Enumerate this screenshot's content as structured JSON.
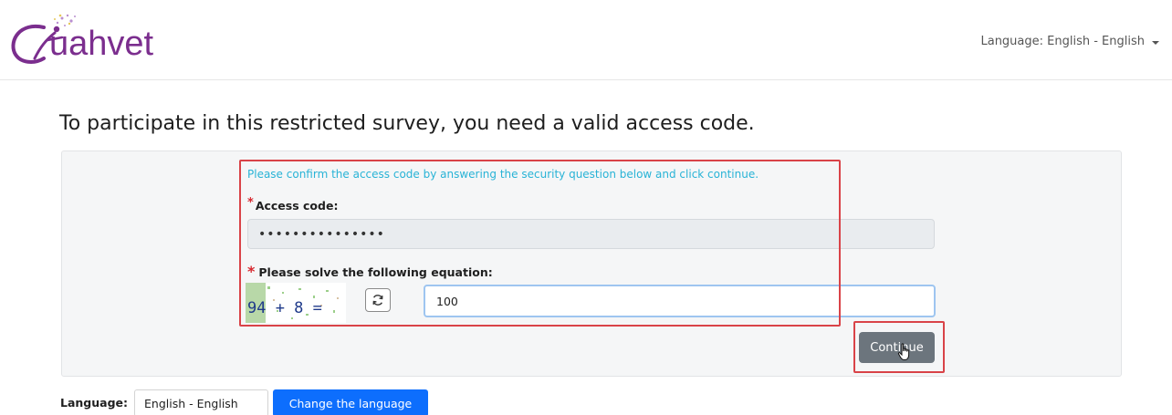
{
  "header": {
    "logo_text": "uahvet",
    "language_menu": "Language: English - English"
  },
  "main": {
    "heading": "To participate in this restricted survey, you need a valid access code.",
    "info_text": "Please confirm the access code by answering the security question below and click continue.",
    "access_code": {
      "required_mark": "*",
      "label": "Access code:",
      "value": "•••••••••••••••"
    },
    "equation": {
      "required_mark": "*",
      "label": "Please solve the following equation:",
      "captcha_text": "94 + 8 =",
      "answer_value": "100"
    },
    "continue_label": "Continue"
  },
  "footer": {
    "language_label": "Language:",
    "language_selected": "English - English",
    "change_label": "Change the language"
  },
  "colors": {
    "info": "#28b3d6",
    "required": "#d7282f",
    "highlight": "#d94348",
    "primary_button": "#0d6efd",
    "secondary_button": "#6c757d",
    "logo_purple": "#7b2e8e"
  }
}
